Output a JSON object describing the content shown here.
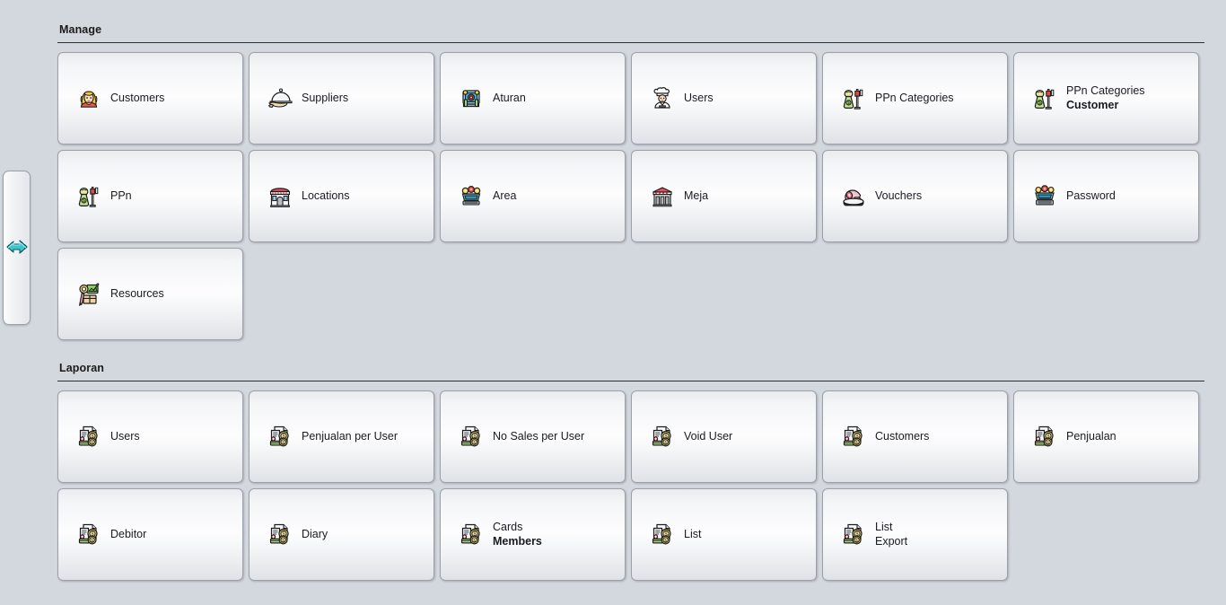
{
  "page": {
    "background_color": "#d3d7de",
    "tile_border_color": "#9ba1ab"
  },
  "side_tab": {
    "name": "slide-out-panel-handle",
    "icon": "double-arrow-right-icon",
    "arrow_color": "#3fc3cc"
  },
  "sections": [
    {
      "id": "manage",
      "title": "Manage",
      "rows": [
        [
          {
            "icon": "customer-face-icon",
            "lines": [
              {
                "text": "Customers",
                "bold": false
              }
            ]
          },
          {
            "icon": "serving-dish-icon",
            "lines": [
              {
                "text": "Suppliers",
                "bold": false
              }
            ]
          },
          {
            "icon": "machine-rules-icon",
            "lines": [
              {
                "text": "Aturan",
                "bold": false
              }
            ]
          },
          {
            "icon": "chef-user-icon",
            "lines": [
              {
                "text": "Users",
                "bold": false
              }
            ]
          },
          {
            "icon": "tax-scale-icon",
            "lines": [
              {
                "text": "PPn Categories",
                "bold": false
              }
            ]
          },
          {
            "icon": "tax-scale-icon",
            "lines": [
              {
                "text": "PPn Categories",
                "bold": false
              },
              {
                "text": "Customer",
                "bold": true
              }
            ]
          }
        ],
        [
          {
            "icon": "tax-scale-icon",
            "lines": [
              {
                "text": "PPn",
                "bold": false
              }
            ]
          },
          {
            "icon": "storefront-icon",
            "lines": [
              {
                "text": "Locations",
                "bold": false
              }
            ]
          },
          {
            "icon": "area-terminal-icon",
            "lines": [
              {
                "text": "Area",
                "bold": false
              }
            ]
          },
          {
            "icon": "table-building-icon",
            "lines": [
              {
                "text": "Meja",
                "bold": false
              }
            ]
          },
          {
            "icon": "voucher-ham-icon",
            "lines": [
              {
                "text": "Vouchers",
                "bold": false
              }
            ]
          },
          {
            "icon": "password-terminal-icon",
            "lines": [
              {
                "text": "Password",
                "bold": false
              }
            ]
          }
        ],
        [
          {
            "icon": "resources-toolbox-icon",
            "lines": [
              {
                "text": "Resources",
                "bold": false
              }
            ]
          },
          null,
          null,
          null,
          null,
          null
        ]
      ]
    },
    {
      "id": "laporan",
      "title": "Laporan",
      "rows": [
        [
          {
            "icon": "report-money-icon",
            "lines": [
              {
                "text": "Users",
                "bold": false
              }
            ]
          },
          {
            "icon": "report-money-icon",
            "lines": [
              {
                "text": "Penjualan per User",
                "bold": false
              }
            ]
          },
          {
            "icon": "report-money-icon",
            "lines": [
              {
                "text": "No Sales per User",
                "bold": false
              }
            ]
          },
          {
            "icon": "report-money-icon",
            "lines": [
              {
                "text": "Void User",
                "bold": false
              }
            ]
          },
          {
            "icon": "report-money-icon",
            "lines": [
              {
                "text": "Customers",
                "bold": false
              }
            ]
          },
          {
            "icon": "report-money-icon",
            "lines": [
              {
                "text": "Penjualan",
                "bold": false
              }
            ]
          }
        ],
        [
          {
            "icon": "report-money-icon",
            "lines": [
              {
                "text": "Debitor",
                "bold": false
              }
            ]
          },
          {
            "icon": "report-money-icon",
            "lines": [
              {
                "text": "Diary",
                "bold": false
              }
            ]
          },
          {
            "icon": "report-money-icon",
            "lines": [
              {
                "text": "Cards",
                "bold": false
              },
              {
                "text": "Members",
                "bold": true
              }
            ]
          },
          {
            "icon": "report-money-icon",
            "lines": [
              {
                "text": "List",
                "bold": false
              }
            ]
          },
          {
            "icon": "report-money-icon",
            "lines": [
              {
                "text": "List",
                "bold": false
              },
              {
                "text": "Export",
                "bold": false
              }
            ]
          },
          null
        ]
      ]
    }
  ]
}
